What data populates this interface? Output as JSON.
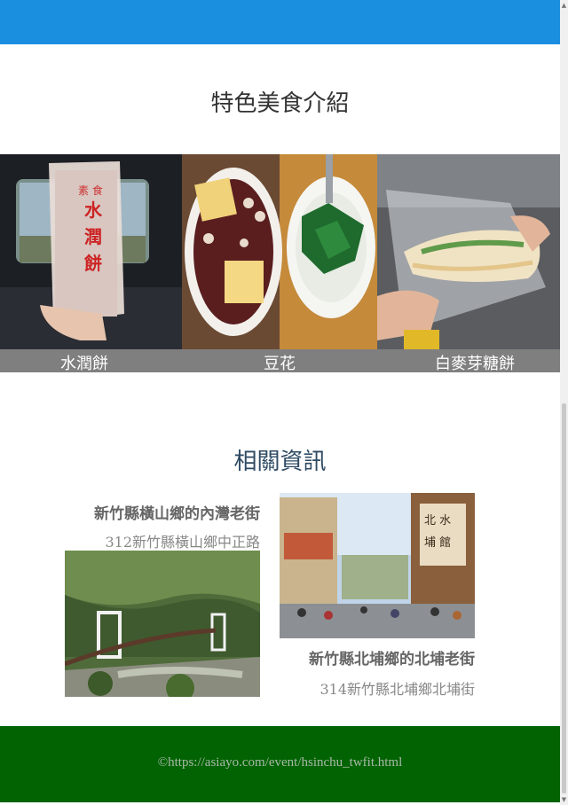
{
  "colors": {
    "topbar": "#1a8fe0",
    "footer": "#026302",
    "food_label_bar": "#7f7f7f"
  },
  "food_section": {
    "title": "特色美食介紹",
    "items": [
      {
        "label": "水潤餅"
      },
      {
        "label": "豆花"
      },
      {
        "label": "白麥芽糖餅"
      }
    ]
  },
  "info_section": {
    "title": "相關資訊",
    "items": [
      {
        "name": "新竹縣橫山鄉的內灣老街",
        "address": "312新竹縣橫山鄉中正路"
      },
      {
        "name": "新竹縣北埔鄉的北埔老街",
        "address": "314新竹縣北埔鄉北埔街"
      }
    ]
  },
  "footer": {
    "text": "©https://asiayo.com/event/hsinchu_twfit.html"
  }
}
